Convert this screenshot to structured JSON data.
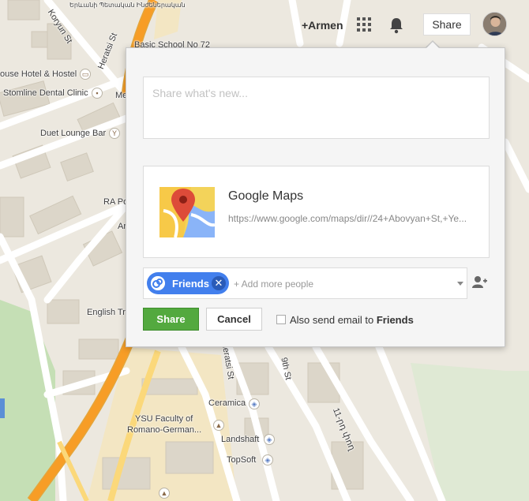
{
  "map": {
    "labels": {
      "top_street_sign": "Երևանի Պետական Ինժեներական",
      "koryun_st": "Koryun St",
      "heratsi_st": "Heratsi St",
      "heratsi_st_lower": "Heratsi St",
      "basic_school": "Basic School No 72",
      "house_hotel": "ouse Hotel & Hostel",
      "stomline": "Stomline Dental Clinic",
      "me_label": "Me",
      "duet_lounge": "Duet Lounge Bar",
      "ra_po": "RA Po",
      "ar_label": "Ar",
      "english_tr": "English Tr",
      "ninth_st": "9th St",
      "armenian_street": "11-րդ փող",
      "ceramica": "Ceramica",
      "ysu_faculty": "YSU Faculty of",
      "romano_germanic": "Romano-German...",
      "landshaft": "Landshaft",
      "topsoft": "TopSoft"
    }
  },
  "topbar": {
    "account_name": "+Armen",
    "apps_icon": "apps-grid-icon",
    "bell_icon": "bell-icon",
    "share_label": "Share"
  },
  "dialog": {
    "post_placeholder": "Share what's new...",
    "link": {
      "title": "Google Maps",
      "url": "https://www.google.com/maps/dir//24+Abovyan+St,+Ye..."
    },
    "recipients": {
      "chip_label": "Friends",
      "add_more_placeholder": "+ Add more people"
    },
    "buttons": {
      "share": "Share",
      "cancel": "Cancel"
    },
    "email_option": {
      "prefix": "Also send email to ",
      "circle": "Friends",
      "checked": false
    }
  },
  "colors": {
    "share_green": "#53a93f",
    "chip_blue": "#427fed",
    "highway_orange": "#f79d26"
  }
}
